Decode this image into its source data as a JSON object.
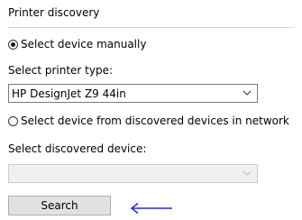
{
  "group": {
    "title": "Printer discovery"
  },
  "manual": {
    "radio_label": "Select device manually",
    "selected": true,
    "type_label": "Select printer type:",
    "type_value": "HP DesignJet Z9 44in"
  },
  "discovered": {
    "radio_label": "Select device from discovered devices in network",
    "selected": false,
    "device_label": "Select discovered device:",
    "device_value": ""
  },
  "search": {
    "button_label": "Search"
  },
  "colors": {
    "arrow": "#1f2fd1",
    "button_bg": "#e1e1e1",
    "disabled_bg": "#f0f0f0"
  },
  "icons": {
    "arrow": "left-arrow-icon",
    "dropdown": "chevron-down-icon"
  }
}
